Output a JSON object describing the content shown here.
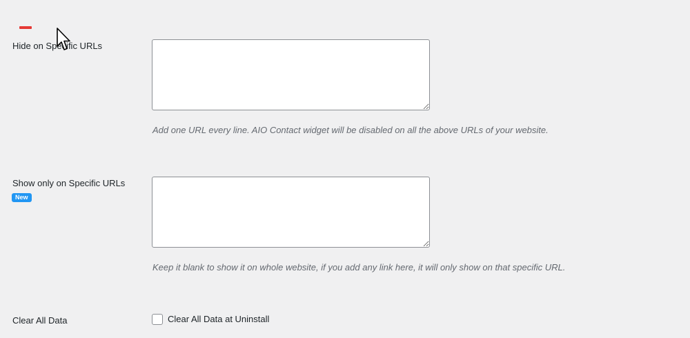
{
  "settings": {
    "hide_urls": {
      "label": "Hide on Specific URLs",
      "value": "",
      "help": "Add one URL every line. AIO Contact widget will be disabled on all the above URLs of your website."
    },
    "show_urls": {
      "label": "Show only on Specific URLs",
      "badge": "New",
      "value": "",
      "help": "Keep it blank to show it on whole website, if you add any link here, it will only show on that specific URL."
    },
    "clear_data": {
      "label": "Clear All Data",
      "checkbox_label": "Clear All Data at Uninstall",
      "checked": false
    }
  },
  "colors": {
    "background": "#f0f0f1",
    "badge": "#2196f3",
    "marker": "#e53935"
  },
  "icons": {
    "cursor": "mouse-pointer-icon"
  }
}
